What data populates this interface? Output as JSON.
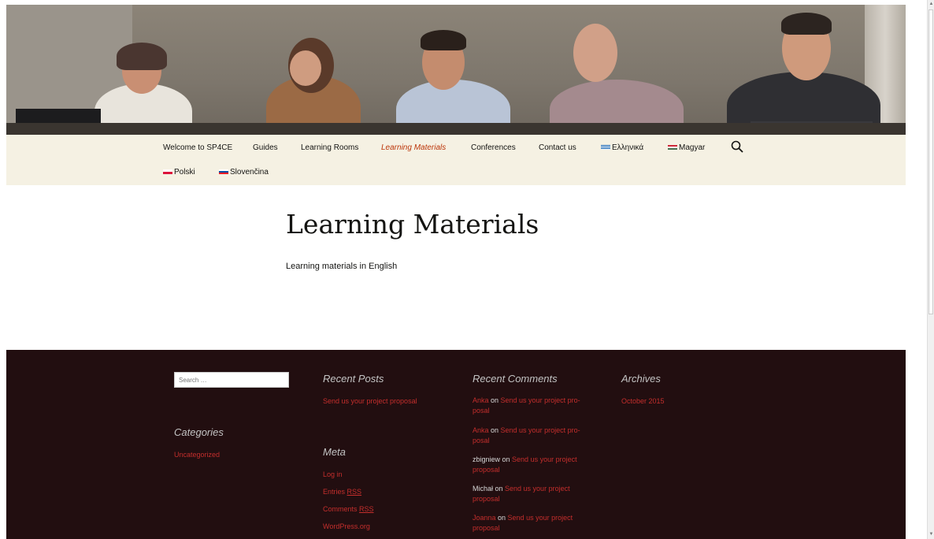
{
  "nav": {
    "items": [
      {
        "label": "Welcome to SP4CE"
      },
      {
        "label": "Guides"
      },
      {
        "label": "Learning Rooms"
      },
      {
        "label": "Learning Materials"
      },
      {
        "label": "Conferences"
      },
      {
        "label": "Contact us"
      },
      {
        "label": "Ελληνικά"
      },
      {
        "label": "Magyar"
      },
      {
        "label": "Polski"
      },
      {
        "label": "Slovenčina"
      }
    ],
    "active_color": "#bc360a"
  },
  "page": {
    "title": "Learning Materials",
    "subtitle": "Learning materials in English"
  },
  "footer": {
    "search_placeholder": "Search …",
    "recent_posts": {
      "title": "Recent Posts",
      "items": [
        "Send us your project proposal"
      ]
    },
    "categories": {
      "title": "Categories",
      "items": [
        "Uncategorized"
      ]
    },
    "meta": {
      "title": "Meta",
      "items": [
        "Log in",
        "Entries",
        "RSS",
        "Comments",
        "RSS",
        "WordPress.org"
      ]
    },
    "recent_comments": {
      "title": "Recent Comments",
      "items": [
        {
          "author": "Anka",
          "sep": " on ",
          "post": "Send us your project pro-posal"
        },
        {
          "author": "Anka",
          "sep": " on ",
          "post": "Send us your project pro-posal"
        },
        {
          "author": "zbigniew",
          "sep": " on ",
          "post": "Send us your project proposal"
        },
        {
          "author": "Michał",
          "sep": " on ",
          "post": "Send us your project proposal"
        },
        {
          "author": "Joanna",
          "sep": " on ",
          "post": "Send us your project proposal"
        }
      ]
    },
    "archives": {
      "title": "Archives",
      "items": [
        "October 2015"
      ]
    },
    "bg_color": "#220e10",
    "link_color": "#c42e2c"
  }
}
